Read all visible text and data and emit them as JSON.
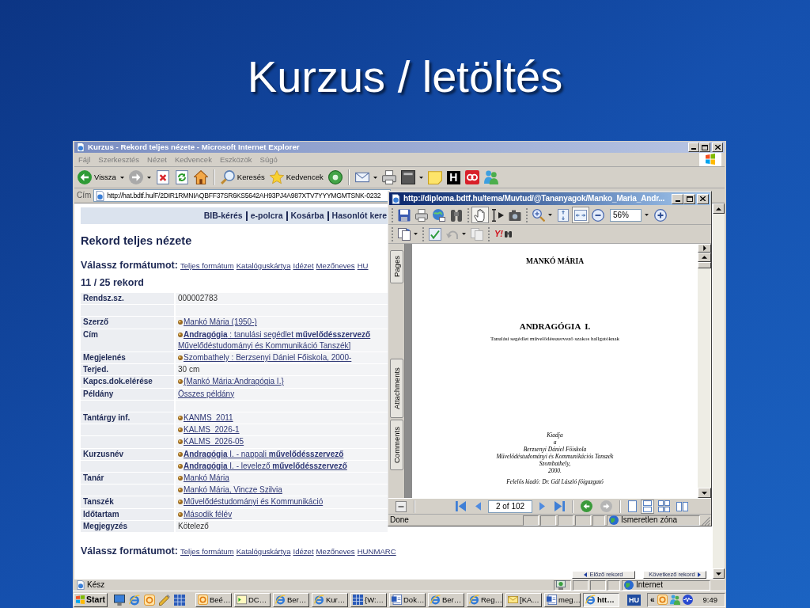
{
  "slide": {
    "title": "Kurzus / letöltés"
  },
  "browser": {
    "title": "Kurzus - Rekord teljes nézete - Microsoft Internet Explorer",
    "menu": [
      "Fájl",
      "Szerkesztés",
      "Nézet",
      "Kedvencek",
      "Eszközök",
      "Súgó"
    ],
    "toolbar": [
      {
        "kind": "back",
        "label": "Vissza",
        "dropdown": true
      },
      {
        "kind": "forward",
        "dropdown": true
      },
      {
        "kind": "stop",
        "dropdown": false
      },
      {
        "kind": "refresh",
        "dropdown": false
      },
      {
        "kind": "home",
        "dropdown": false
      },
      {
        "kind": "separator"
      },
      {
        "kind": "search",
        "label": "Keresés",
        "dropdown": false
      },
      {
        "kind": "favorites",
        "label": "Kedvencek",
        "dropdown": false
      },
      {
        "kind": "media",
        "dropdown": false
      },
      {
        "kind": "separator"
      },
      {
        "kind": "mail",
        "dropdown": true
      },
      {
        "kind": "print",
        "dropdown": false
      },
      {
        "kind": "edit",
        "dropdown": true
      },
      {
        "kind": "notes",
        "dropdown": false
      },
      {
        "kind": "letter",
        "label": "H",
        "dropdown": false
      },
      {
        "kind": "addon",
        "dropdown": false
      },
      {
        "kind": "messenger",
        "dropdown": false
      }
    ],
    "address": {
      "label": "Cím",
      "url": "http://hat.bdtf.hu/F/2DIR1RMNIAQBFF37SR6KS5642AH93PJ4A987XTV7YYYMGMTSNK-0232"
    },
    "page": {
      "nav_links": [
        "BIB-kérés",
        "e-polcra",
        "Kosárba",
        "Hasonlót kere"
      ],
      "heading": "Rekord teljes nézete",
      "formats_top": {
        "label": "Válassz formátumot:",
        "links": [
          "Teljes formátum",
          "Katalóguskártya",
          "Idézet",
          "Mezőneves",
          "HU"
        ]
      },
      "record_count": "11 / 25 rekord",
      "rows": [
        {
          "kind": "field",
          "label": "Rendsz.sz.",
          "values": [
            {
              "text": "000002783",
              "kind": "text",
              "bullet": false
            }
          ]
        },
        {
          "kind": "blank"
        },
        {
          "kind": "field",
          "label": "Szerző",
          "values": [
            {
              "text": "Mankó Mária (1950-)",
              "kind": "link",
              "bullet": true
            }
          ]
        },
        {
          "kind": "field",
          "label": "Cím",
          "values": [
            {
              "text": "**Andragógia** : tanulási segédlet **művelődésszervező**",
              "kind": "link",
              "bullet": true
            },
            {
              "text": "Művelődéstudományi és Kommunikáció Tanszék]",
              "kind": "link",
              "bullet": false
            }
          ]
        },
        {
          "kind": "field",
          "label": "Megjelenés",
          "values": [
            {
              "text": "Szombathely : Berzsenyi Dániel Főiskola, 2000-",
              "kind": "link",
              "bullet": true
            }
          ]
        },
        {
          "kind": "field",
          "label": "Terjed.",
          "values": [
            {
              "text": "30 cm",
              "kind": "text",
              "bullet": false
            }
          ]
        },
        {
          "kind": "field",
          "label": "Kapcs.dok.elérése",
          "values": [
            {
              "text": "{Mankó Mária:Andragógia I.}",
              "kind": "link",
              "bullet": true
            }
          ]
        },
        {
          "kind": "field",
          "label": "Példány",
          "values": [
            {
              "text": "Összes példány",
              "kind": "link",
              "bullet": false
            }
          ]
        },
        {
          "kind": "blank"
        },
        {
          "kind": "field",
          "label": "Tantárgy inf.",
          "values": [
            {
              "text": "KANMS_2011",
              "kind": "link",
              "bullet": true
            }
          ]
        },
        {
          "kind": "field",
          "values": [
            {
              "text": "KALMS_2026-1",
              "kind": "link",
              "bullet": true
            }
          ]
        },
        {
          "kind": "field",
          "values": [
            {
              "text": "KALMS_2026-05",
              "kind": "link",
              "bullet": true
            }
          ]
        },
        {
          "kind": "field",
          "label": "Kurzusnév",
          "values": [
            {
              "text": "**Andragógia** I. - nappali **művelődésszervező**",
              "kind": "link",
              "bullet": true
            }
          ]
        },
        {
          "kind": "field",
          "values": [
            {
              "text": "**Andragógia** I. - levelező **művelődésszervező**",
              "kind": "link",
              "bullet": true
            }
          ]
        },
        {
          "kind": "field",
          "label": "Tanár",
          "values": [
            {
              "text": "Mankó Mária",
              "kind": "link",
              "bullet": true
            }
          ]
        },
        {
          "kind": "field",
          "values": [
            {
              "text": "Mankó Mária, Vincze Szilvia",
              "kind": "link",
              "bullet": true
            }
          ]
        },
        {
          "kind": "field",
          "label": "Tanszék",
          "values": [
            {
              "text": "Művelődéstudományi és Kommunikáció",
              "kind": "link",
              "bullet": true
            }
          ]
        },
        {
          "kind": "field",
          "label": "Időtartam",
          "values": [
            {
              "text": "Második félév",
              "kind": "link",
              "bullet": true
            }
          ]
        },
        {
          "kind": "field",
          "label": "Megjegyzés",
          "values": [
            {
              "text": "Kötelező",
              "kind": "text",
              "bullet": false
            }
          ]
        }
      ],
      "formats_bottom": {
        "label": "Válassz formátumot:",
        "links": [
          "Teljes formátum",
          "Katalóguskártya",
          "Idézet",
          "Mezőneves",
          "HUNMARC"
        ]
      },
      "record_buttons": [
        {
          "kind": "previous",
          "label": "Előző rekord"
        },
        {
          "kind": "next",
          "label": "Következő rekord"
        }
      ]
    },
    "status": {
      "text": "Kész",
      "zone": "Internet"
    }
  },
  "pdf_viewer": {
    "title": "http://diploma.bdtf.hu/tema/Muvtud/@Tananyagok/Manko_Maria_Andr...",
    "toolbars": [
      [
        [
          {
            "kind": "save",
            "pressed": false
          },
          {
            "kind": "print",
            "pressed": false
          },
          {
            "kind": "email",
            "pressed": false
          },
          {
            "kind": "find",
            "pressed": false
          }
        ],
        [
          {
            "kind": "hand",
            "pressed": true
          },
          {
            "kind": "select_text",
            "pressed": false
          },
          {
            "kind": "snapshot",
            "pressed": false
          }
        ],
        [
          {
            "kind": "zoom_tool",
            "pressed": false,
            "dropdown": true
          },
          {
            "kind": "fit_page",
            "pressed": false
          },
          {
            "kind": "fit_width",
            "pressed": true
          },
          {
            "kind": "zoom_out",
            "pressed": false
          },
          {
            "kind": "zoom_field",
            "value": "56%",
            "dropdown": true
          },
          {
            "kind": "zoom_in",
            "pressed": false
          }
        ]
      ],
      [
        [
          {
            "kind": "pages",
            "pressed": false,
            "dropdown": true
          }
        ],
        [
          {
            "kind": "spelling",
            "pressed": false
          },
          {
            "kind": "undo",
            "pressed": false,
            "dropdown": true
          },
          {
            "kind": "copy",
            "pressed": false
          }
        ],
        [
          {
            "kind": "search_logo",
            "label": "Y!",
            "pressed": false
          }
        ]
      ]
    ],
    "side_tabs": [
      "Pages",
      "Attachments",
      "Comments"
    ],
    "document": {
      "author": "MANKÓ MÁRIA",
      "title": "ANDRAGÓGIA  I.",
      "subtitle": "Tanulási segédlet művelődésszervező szakos hallgatóknak",
      "imprint": [
        "Kiadja",
        "a",
        "Berzsenyi Dániel Főiskola",
        "Művelődéstudományi és Kommunikációs Tanszék",
        "Szombathely,",
        "2000."
      ],
      "publisher": "Felelős kiadó: Dr. Gál László főigazgató"
    },
    "navigation": [
      [
        {
          "kind": "panel"
        }
      ],
      [
        {
          "kind": "first"
        },
        {
          "kind": "previous"
        },
        {
          "kind": "page_field",
          "value": "2 of 102"
        },
        {
          "kind": "next"
        },
        {
          "kind": "last"
        }
      ],
      [
        {
          "kind": "back",
          "disabled": false
        },
        {
          "kind": "forward",
          "disabled": true
        }
      ],
      [
        {
          "kind": "single",
          "pressed": false
        },
        {
          "kind": "continuous",
          "pressed": true
        },
        {
          "kind": "continuous_facing",
          "pressed": false
        },
        {
          "kind": "facing",
          "pressed": false
        }
      ]
    ],
    "status": {
      "text": "Done",
      "zone": "Ismeretlen zóna"
    }
  },
  "taskbar": {
    "start": "Start",
    "quick_launch": [
      {
        "kind": "desktop"
      },
      {
        "kind": "ie"
      },
      {
        "kind": "app"
      },
      {
        "kind": "tools"
      },
      {
        "kind": "grid"
      }
    ],
    "tasks": [
      {
        "label": "Beé…",
        "kind": "app",
        "selected": false
      },
      {
        "label": "DC…",
        "kind": "terminal",
        "selected": false
      },
      {
        "label": "Ber…",
        "kind": "ie",
        "selected": false
      },
      {
        "label": "Kur…",
        "kind": "ie",
        "selected": false
      },
      {
        "label": "{W:…",
        "kind": "grid",
        "selected": false
      },
      {
        "label": "Dok…",
        "kind": "word",
        "selected": false
      },
      {
        "label": "Ber…",
        "kind": "ie",
        "selected": false
      },
      {
        "label": "Reg…",
        "kind": "ie",
        "selected": false
      },
      {
        "label": "[KA…",
        "kind": "mail",
        "selected": false
      },
      {
        "label": "meg…",
        "kind": "word",
        "selected": false
      },
      {
        "label": "htt…",
        "kind": "ie",
        "selected": true
      }
    ],
    "language": "HU",
    "tray_toggle": "«",
    "tray": [
      {
        "kind": "app"
      },
      {
        "kind": "network"
      },
      {
        "kind": "audio"
      }
    ],
    "clock": "9:49"
  }
}
